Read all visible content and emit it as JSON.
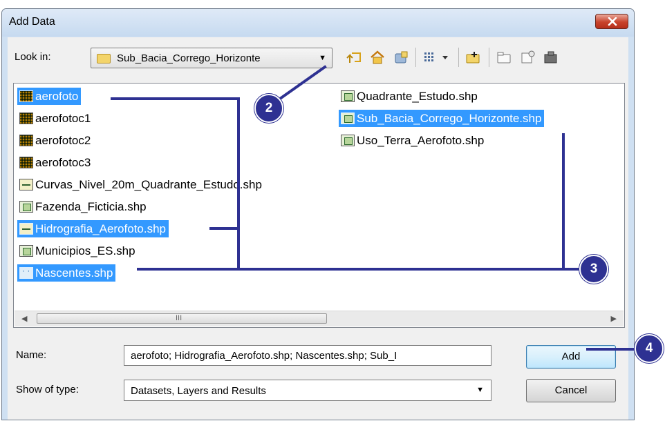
{
  "window": {
    "title": "Add Data"
  },
  "toolbar": {
    "lookin_label": "Look in:",
    "lookin_value": "Sub_Bacia_Corrego_Horizonte",
    "icons": [
      "up-one-level-icon",
      "home-icon",
      "catalog-icon",
      "view-menu-icon",
      "connect-folder-icon",
      "new-folder-icon",
      "new-item-icon",
      "toolbox-icon"
    ]
  },
  "files": {
    "col1": [
      {
        "label": "aerofoto",
        "type": "raster",
        "selected": true
      },
      {
        "label": "aerofotoc1",
        "type": "raster",
        "selected": false
      },
      {
        "label": "aerofotoc2",
        "type": "raster",
        "selected": false
      },
      {
        "label": "aerofotoc3",
        "type": "raster",
        "selected": false
      },
      {
        "label": "Curvas_Nivel_20m_Quadrante_Estudo.shp",
        "type": "line",
        "selected": false
      },
      {
        "label": "Fazenda_Ficticia.shp",
        "type": "polygon",
        "selected": false
      },
      {
        "label": "Hidrografia_Aerofoto.shp",
        "type": "line",
        "selected": true
      },
      {
        "label": "Municipios_ES.shp",
        "type": "polygon",
        "selected": false
      },
      {
        "label": "Nascentes.shp",
        "type": "point",
        "selected": true
      }
    ],
    "col2": [
      {
        "label": "Quadrante_Estudo.shp",
        "type": "polygon",
        "selected": false
      },
      {
        "label": "Sub_Bacia_Corrego_Horizonte.shp",
        "type": "polygon",
        "selected": true
      },
      {
        "label": "Uso_Terra_Aerofoto.shp",
        "type": "polygon",
        "selected": false
      }
    ]
  },
  "scrollbar": {
    "grip": "III"
  },
  "form": {
    "name_label": "Name:",
    "name_value": "aerofoto; Hidrografia_Aerofoto.shp; Nascentes.shp; Sub_I",
    "type_label": "Show of type:",
    "type_value": "Datasets, Layers and Results"
  },
  "buttons": {
    "add": "Add",
    "cancel": "Cancel"
  },
  "annotations": {
    "b2": "2",
    "b3": "3",
    "b4": "4",
    "color": "#2e3192"
  },
  "colors": {
    "selection": "#3399ff",
    "title_bar": "#cfe0f2",
    "close": "#c8432c"
  }
}
